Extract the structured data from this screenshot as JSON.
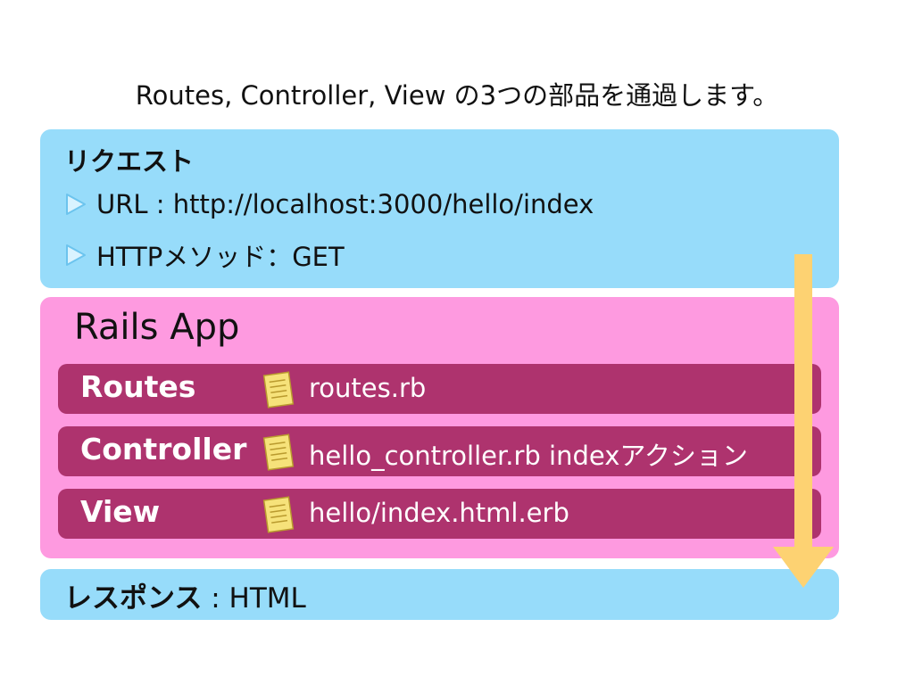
{
  "subtitle": "Routes, Controller, View の3つの部品を通過します。",
  "request": {
    "title": "リクエスト",
    "bullets": [
      {
        "text": "URL : http://localhost:3000/hello/index",
        "icon": "triangle-bullet-icon"
      },
      {
        "text": "HTTPメソッド：GET",
        "icon": "triangle-bullet-icon"
      }
    ]
  },
  "rails": {
    "title": "Rails App",
    "rows": [
      {
        "label": "Routes",
        "file": "routes.rb",
        "icon": "file-icon"
      },
      {
        "label": "Controller",
        "file": "hello_controller.rb indexアクション",
        "icon": "file-icon"
      },
      {
        "label": "View",
        "file": "hello/index.html.erb",
        "icon": "file-icon"
      }
    ]
  },
  "response": {
    "label": "レスポンス",
    "value": " : HTML"
  },
  "colors": {
    "request_bg": "#97dcfa",
    "rails_bg": "#fe9ae0",
    "row_bg": "#ae336e",
    "arrow": "#fdd272",
    "file_icon": "#f6e27a"
  }
}
